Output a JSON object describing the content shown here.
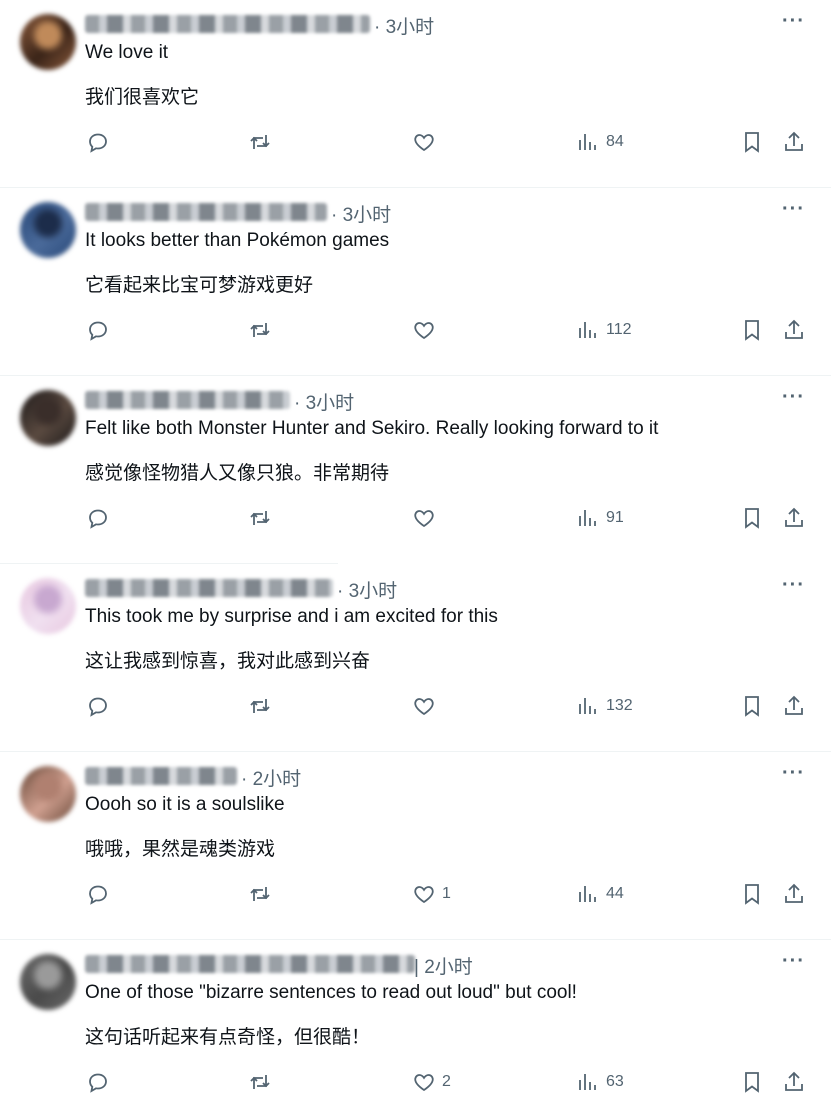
{
  "replies": [
    {
      "time": "· 3小时",
      "text_en": "We love it",
      "text_zh": "我们很喜欢它",
      "likes": "",
      "views": "84",
      "avatar_colors": [
        "#8a5a3c",
        "#c08a5a",
        "#3a2418"
      ]
    },
    {
      "time": "· 3小时",
      "text_en": "It looks better than Pokémon games",
      "text_zh": "它看起来比宝可梦游戏更好",
      "likes": "",
      "views": "112",
      "avatar_colors": [
        "#2a4a7a",
        "#1c2c4a",
        "#4a6a9a"
      ]
    },
    {
      "time": "· 3小时",
      "text_en": "Felt like both Monster Hunter and Sekiro. Really looking forward to it",
      "text_zh": "感觉像怪物猎人又像只狼。非常期待",
      "likes": "",
      "views": "91",
      "avatar_colors": [
        "#1e1a1a",
        "#3a2e2a",
        "#5a4a40"
      ]
    },
    {
      "time": "· 3小时",
      "text_en": "This took me by surprise and i am excited for this",
      "text_zh": "这让我感到惊喜，我对此感到兴奋",
      "likes": "",
      "views": "132",
      "avatar_colors": [
        "#e8c8e0",
        "#c8a8d0",
        "#f0e0f0"
      ]
    },
    {
      "time": "· 2小时",
      "text_en": "Oooh so it is a soulslike",
      "text_zh": "哦哦，果然是魂类游戏",
      "likes": "1",
      "views": "44",
      "avatar_colors": [
        "#6a4a3a",
        "#b08070",
        "#d0a090"
      ]
    },
    {
      "time": "| 2小时",
      "text_en": "One of those \"bizarre sentences to read out loud\" but cool!",
      "text_zh": "这句话听起来有点奇怪，但很酷！",
      "likes": "2",
      "views": "63",
      "avatar_colors": [
        "#6a6a6a",
        "#9a9a9a",
        "#4a4a4a"
      ]
    }
  ],
  "icons": {
    "reply": "reply-icon",
    "repost": "repost-icon",
    "like": "like-icon",
    "views": "views-icon",
    "bookmark": "bookmark-icon",
    "share": "share-icon",
    "more": "more-icon"
  },
  "more_label": "···",
  "colors": {
    "text": "#0f1419",
    "secondary": "#536471",
    "divider": "#eff3f4"
  }
}
